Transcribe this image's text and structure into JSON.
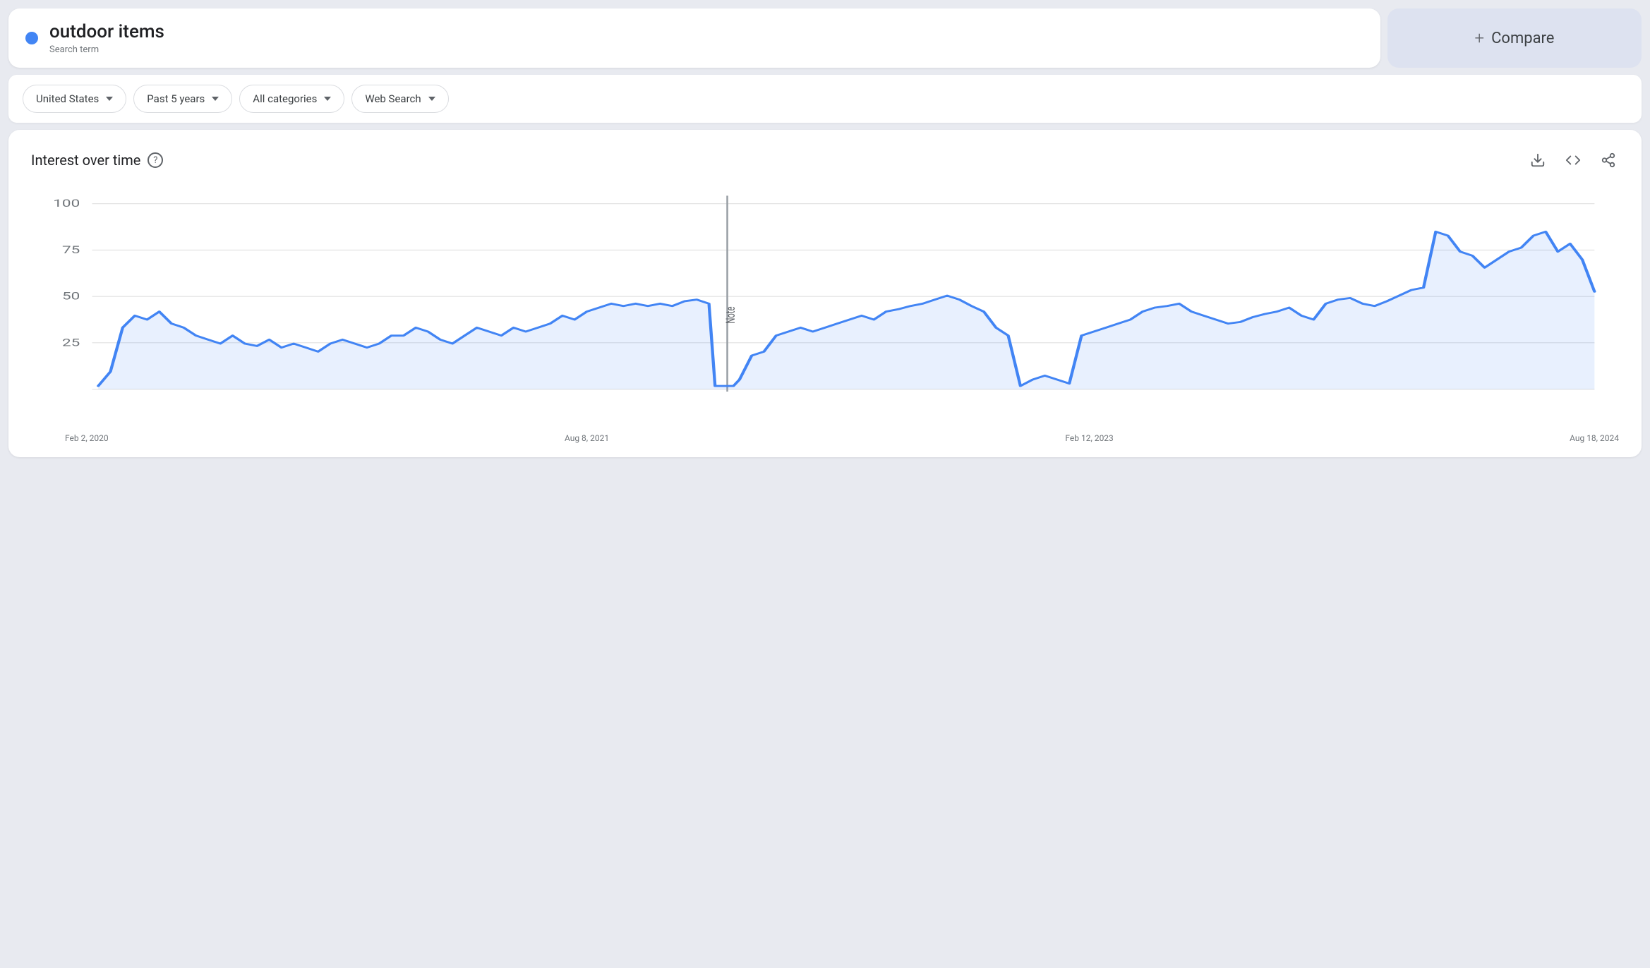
{
  "search": {
    "term": "outdoor items",
    "sublabel": "Search term",
    "dot_color": "#4285f4"
  },
  "compare": {
    "label": "Compare",
    "plus": "+"
  },
  "filters": {
    "region": {
      "label": "United States",
      "has_dropdown": true
    },
    "time": {
      "label": "Past 5 years",
      "has_dropdown": true
    },
    "category": {
      "label": "All categories",
      "has_dropdown": true
    },
    "type": {
      "label": "Web Search",
      "has_dropdown": true
    }
  },
  "chart": {
    "title": "Interest over time",
    "help_icon": "?",
    "download_icon": "⬇",
    "embed_icon": "<>",
    "share_icon": "share",
    "y_labels": [
      "100",
      "75",
      "50",
      "25"
    ],
    "x_labels": [
      "Feb 2, 2020",
      "Aug 8, 2021",
      "Feb 12, 2023",
      "Aug 18, 2024"
    ]
  }
}
